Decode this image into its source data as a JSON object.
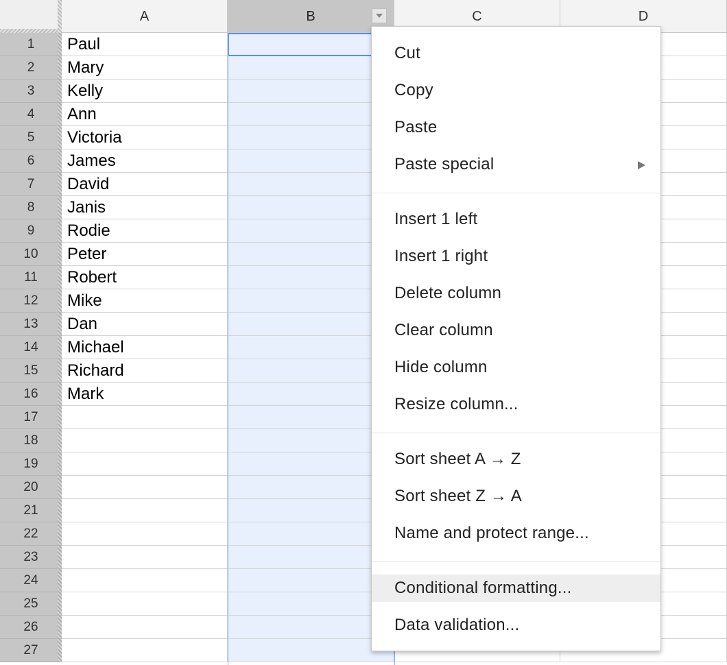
{
  "columns": [
    {
      "label": "A",
      "selected": false
    },
    {
      "label": "B",
      "selected": true
    },
    {
      "label": "C",
      "selected": false
    },
    {
      "label": "D",
      "selected": false
    }
  ],
  "rows": [
    "1",
    "2",
    "3",
    "4",
    "5",
    "6",
    "7",
    "8",
    "9",
    "10",
    "11",
    "12",
    "13",
    "14",
    "15",
    "16",
    "17",
    "18",
    "19",
    "20",
    "21",
    "22",
    "23",
    "24",
    "25",
    "26",
    "27"
  ],
  "column_a_values": [
    "Paul",
    "Mary",
    "Kelly",
    "Ann",
    "Victoria",
    "James",
    "David",
    "Janis",
    "Rodie",
    "Peter",
    "Robert",
    "Mike",
    "Dan",
    "Michael",
    "Richard",
    "Mark",
    "",
    "",
    "",
    "",
    "",
    "",
    "",
    "",
    "",
    "",
    ""
  ],
  "context_menu": {
    "items": [
      {
        "label": "Cut",
        "name": "menu-cut"
      },
      {
        "label": "Copy",
        "name": "menu-copy"
      },
      {
        "label": "Paste",
        "name": "menu-paste"
      },
      {
        "label": "Paste special",
        "name": "menu-paste-special",
        "submenu": true
      },
      {
        "separator": true
      },
      {
        "label": "Insert 1 left",
        "name": "menu-insert-left"
      },
      {
        "label": "Insert 1 right",
        "name": "menu-insert-right"
      },
      {
        "label": "Delete column",
        "name": "menu-delete-column"
      },
      {
        "label": "Clear column",
        "name": "menu-clear-column"
      },
      {
        "label": "Hide column",
        "name": "menu-hide-column"
      },
      {
        "label": "Resize column...",
        "name": "menu-resize-column"
      },
      {
        "separator": true
      },
      {
        "label": "Sort sheet A → Z",
        "name": "menu-sort-a-z"
      },
      {
        "label": "Sort sheet Z → A",
        "name": "menu-sort-z-a"
      },
      {
        "label": "Name and protect range...",
        "name": "menu-name-protect-range"
      },
      {
        "separator": true
      },
      {
        "label": "Conditional formatting...",
        "name": "menu-conditional-formatting",
        "highlighted": true
      },
      {
        "label": "Data validation...",
        "name": "menu-data-validation"
      }
    ]
  },
  "colors": {
    "selected_column": "#e8f0fe",
    "selection_border": "#4d90fe",
    "row_header": "#c6c6c6",
    "menu_hover": "#eeeeee"
  }
}
